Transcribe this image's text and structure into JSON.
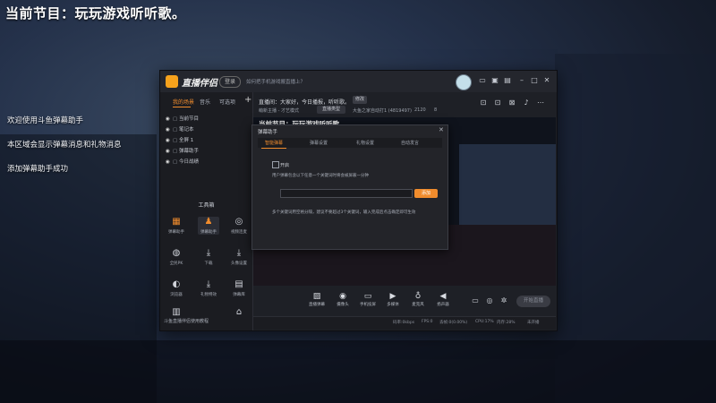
{
  "overlay": {
    "title": "当前节目：玩玩游戏听听歌。",
    "lines": [
      "欢迎使用斗鱼弹幕助手",
      "本区域会显示弹幕消息和礼物消息",
      "添加弹幕助手成功"
    ]
  },
  "app": {
    "name": "直播伴侣",
    "login_label": "登录",
    "notice": "如何把手机游戏搬直播上？",
    "titlebar_icons": [
      "menu-icon",
      "shirt-icon",
      "gift-icon",
      "minimize-icon",
      "maximize-icon",
      "close-icon"
    ],
    "left_tabs": [
      "我的场景",
      "音乐",
      "可选项"
    ],
    "scenes": [
      "当前节目",
      "笔记本",
      "全屏 1",
      "弹幕助手",
      "今日战绩"
    ],
    "toolbox_title": "工具箱",
    "tools": [
      {
        "label": "弹幕助手",
        "icon": "danmu-icon"
      },
      {
        "label": "弹幕助手",
        "icon": "user-icon"
      },
      {
        "label": "视频连麦",
        "icon": "video-icon"
      },
      {
        "label": "全民PK",
        "icon": "pk-icon"
      },
      {
        "label": "下载",
        "icon": "download-icon"
      },
      {
        "label": "头像设置",
        "icon": "download-icon"
      },
      {
        "label": "浏览器",
        "icon": "browser-icon"
      },
      {
        "label": "礼物特效",
        "icon": "gift-icon"
      },
      {
        "label": "弹幕库",
        "icon": "list-icon"
      }
    ],
    "left_status": "斗鱼直播伴侣使用教程",
    "info_line": "直播间：大家好，今日播报，听听歌。",
    "edit_label": "修改",
    "info_sub": "萌新主播 - 才艺模式",
    "category_label": "直播类型",
    "stats": [
      "大鱼之家自动打1 (4819497)",
      "2120",
      "8"
    ],
    "right_icons": [
      "share-icon",
      "chat-icon",
      "group-icon",
      "bell-icon",
      "more-icon"
    ],
    "preview_title": "当前节目：玩玩游戏听听歌。",
    "dialog": {
      "title": "弹幕助手",
      "tabs": [
        "智能弹幕",
        "弹幕设置",
        "礼物设置",
        "自动发言"
      ],
      "check_label": "开启",
      "desc": "用户弹幕包含以下任意一个关键词时将会被屏蔽一分钟",
      "input_value": "",
      "button_label": "添加",
      "note": "多个关键词用空格分隔，建议不要超过3个关键词，输入完成后点击确定即可生效"
    },
    "bottom_tools": [
      {
        "label": "直播弹幕",
        "icon": "image-icon"
      },
      {
        "label": "摄像头",
        "icon": "camera-icon"
      },
      {
        "label": "手机投屏",
        "icon": "phone-icon"
      },
      {
        "label": "多媒体",
        "icon": "media-icon"
      },
      {
        "label": "麦克风",
        "icon": "mic-icon"
      },
      {
        "label": "扬声器",
        "icon": "speaker-icon"
      }
    ],
    "start_live_label": "开始直播",
    "status": [
      "码率:0kbps",
      "FPS:0",
      "丢帧:0(0.00%)",
      "CPU:17%",
      "内存:28%",
      "未开播"
    ]
  }
}
